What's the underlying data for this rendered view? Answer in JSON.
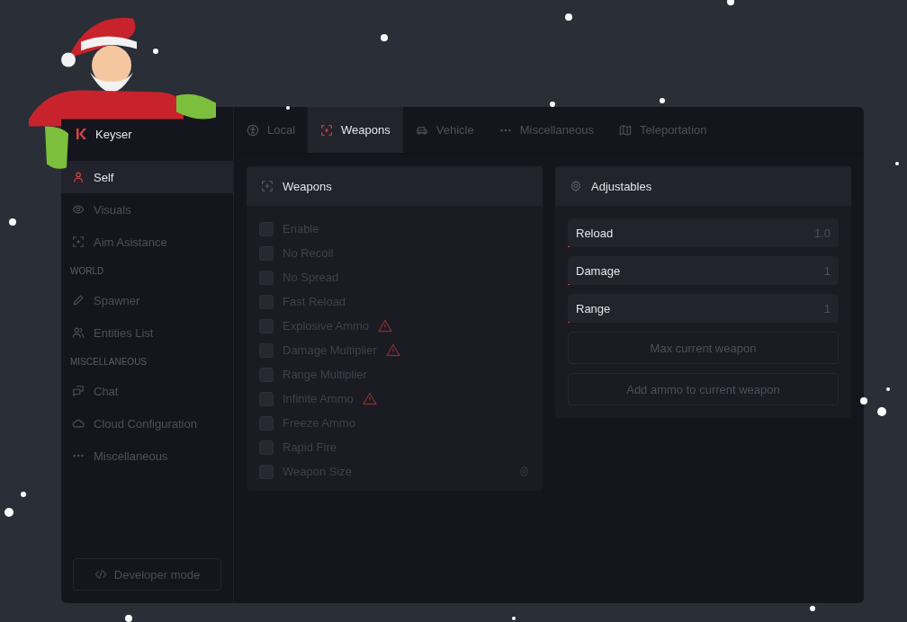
{
  "brand": {
    "name": "Keyser"
  },
  "sidebar": {
    "items": [
      {
        "kind": "item",
        "label": "Self",
        "selected": true
      },
      {
        "kind": "item",
        "label": "Visuals",
        "selected": false
      },
      {
        "kind": "item",
        "label": "Aim Asistance",
        "selected": false
      },
      {
        "kind": "section",
        "label": "WORLD"
      },
      {
        "kind": "item",
        "label": "Spawner",
        "selected": false
      },
      {
        "kind": "item",
        "label": "Entities List",
        "selected": false
      },
      {
        "kind": "section",
        "label": "MISCELLANEOUS"
      },
      {
        "kind": "item",
        "label": "Chat",
        "selected": false
      },
      {
        "kind": "item",
        "label": "Cloud Configuration",
        "selected": false
      },
      {
        "kind": "item",
        "label": "Miscellaneous",
        "selected": false
      }
    ],
    "footer_button": "Developer mode"
  },
  "tabs": [
    {
      "label": "Local",
      "selected": false
    },
    {
      "label": "Weapons",
      "selected": true
    },
    {
      "label": "Vehicle",
      "selected": false
    },
    {
      "label": "Miscellaneous",
      "selected": false
    },
    {
      "label": "Teleportation",
      "selected": false
    }
  ],
  "weapons_panel": {
    "title": "Weapons",
    "options": [
      {
        "label": "Enable",
        "checked": false,
        "warning": false,
        "settings": false
      },
      {
        "label": "No Recoil",
        "checked": false,
        "warning": false,
        "settings": false
      },
      {
        "label": "No Spread",
        "checked": false,
        "warning": false,
        "settings": false
      },
      {
        "label": "Fast Reload",
        "checked": false,
        "warning": false,
        "settings": false
      },
      {
        "label": "Explosive Ammo",
        "checked": false,
        "warning": true,
        "settings": false
      },
      {
        "label": "Damage Multiplier",
        "checked": false,
        "warning": true,
        "settings": false
      },
      {
        "label": "Range Multiplier",
        "checked": false,
        "warning": false,
        "settings": false
      },
      {
        "label": "Infinite Ammo",
        "checked": false,
        "warning": true,
        "settings": false
      },
      {
        "label": "Freeze Ammo",
        "checked": false,
        "warning": false,
        "settings": false
      },
      {
        "label": "Rapid Fire",
        "checked": false,
        "warning": false,
        "settings": false
      },
      {
        "label": "Weapon Size",
        "checked": false,
        "warning": false,
        "settings": true
      }
    ]
  },
  "adjustables_panel": {
    "title": "Adjustables",
    "sliders": [
      {
        "label": "Reload",
        "reading": "1.0",
        "level": 0.005
      },
      {
        "label": "Damage",
        "reading": "1",
        "level": 0.005
      },
      {
        "label": "Range",
        "reading": "1",
        "level": 0.005
      }
    ],
    "buttons": [
      "Max current weapon",
      "Add ammo to current weapon"
    ]
  }
}
